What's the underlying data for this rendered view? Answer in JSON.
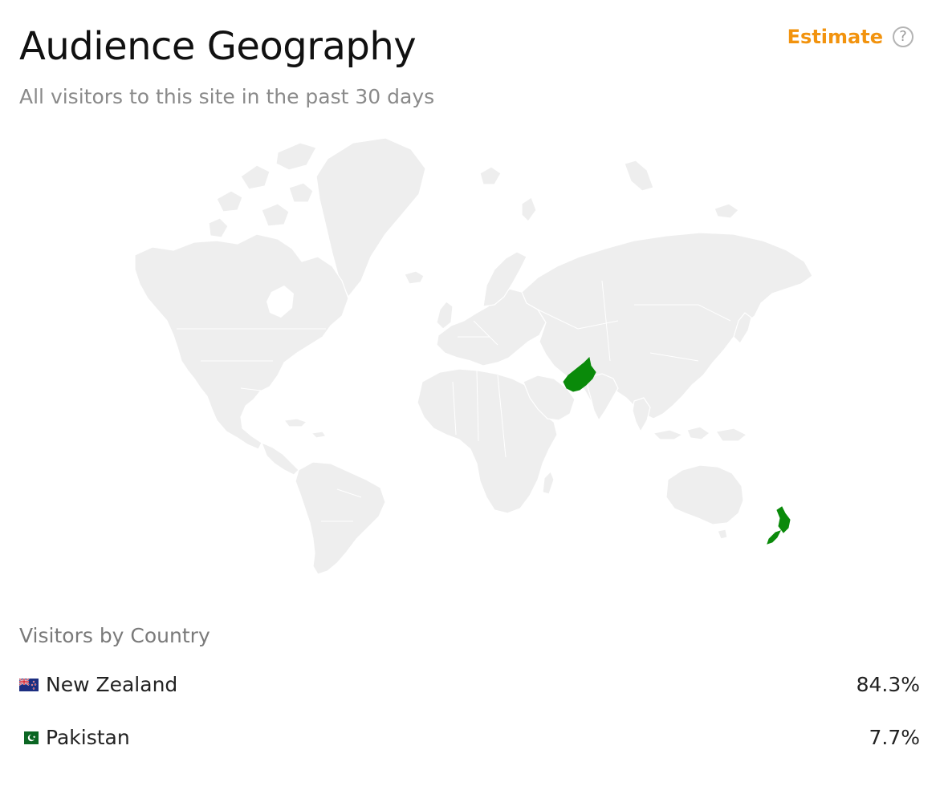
{
  "header": {
    "title": "Audience Geography",
    "subtitle": "All visitors to this site in the past 30 days",
    "estimate_label": "Estimate",
    "help_glyph": "?"
  },
  "map": {
    "base_color": "#eeeeee",
    "highlight_color": "#0a8a0a",
    "highlighted_countries": [
      "New Zealand",
      "Pakistan"
    ]
  },
  "visitors": {
    "title": "Visitors by Country",
    "countries": [
      {
        "name": "New Zealand",
        "percent": "84.3%",
        "flag_icon": "new-zealand-flag-icon"
      },
      {
        "name": "Pakistan",
        "percent": "7.7%",
        "flag_icon": "pakistan-flag-icon"
      }
    ]
  },
  "colors": {
    "accent": "#f2930e",
    "highlight": "#0a8a0a",
    "subtitle": "#8a8a8a"
  }
}
